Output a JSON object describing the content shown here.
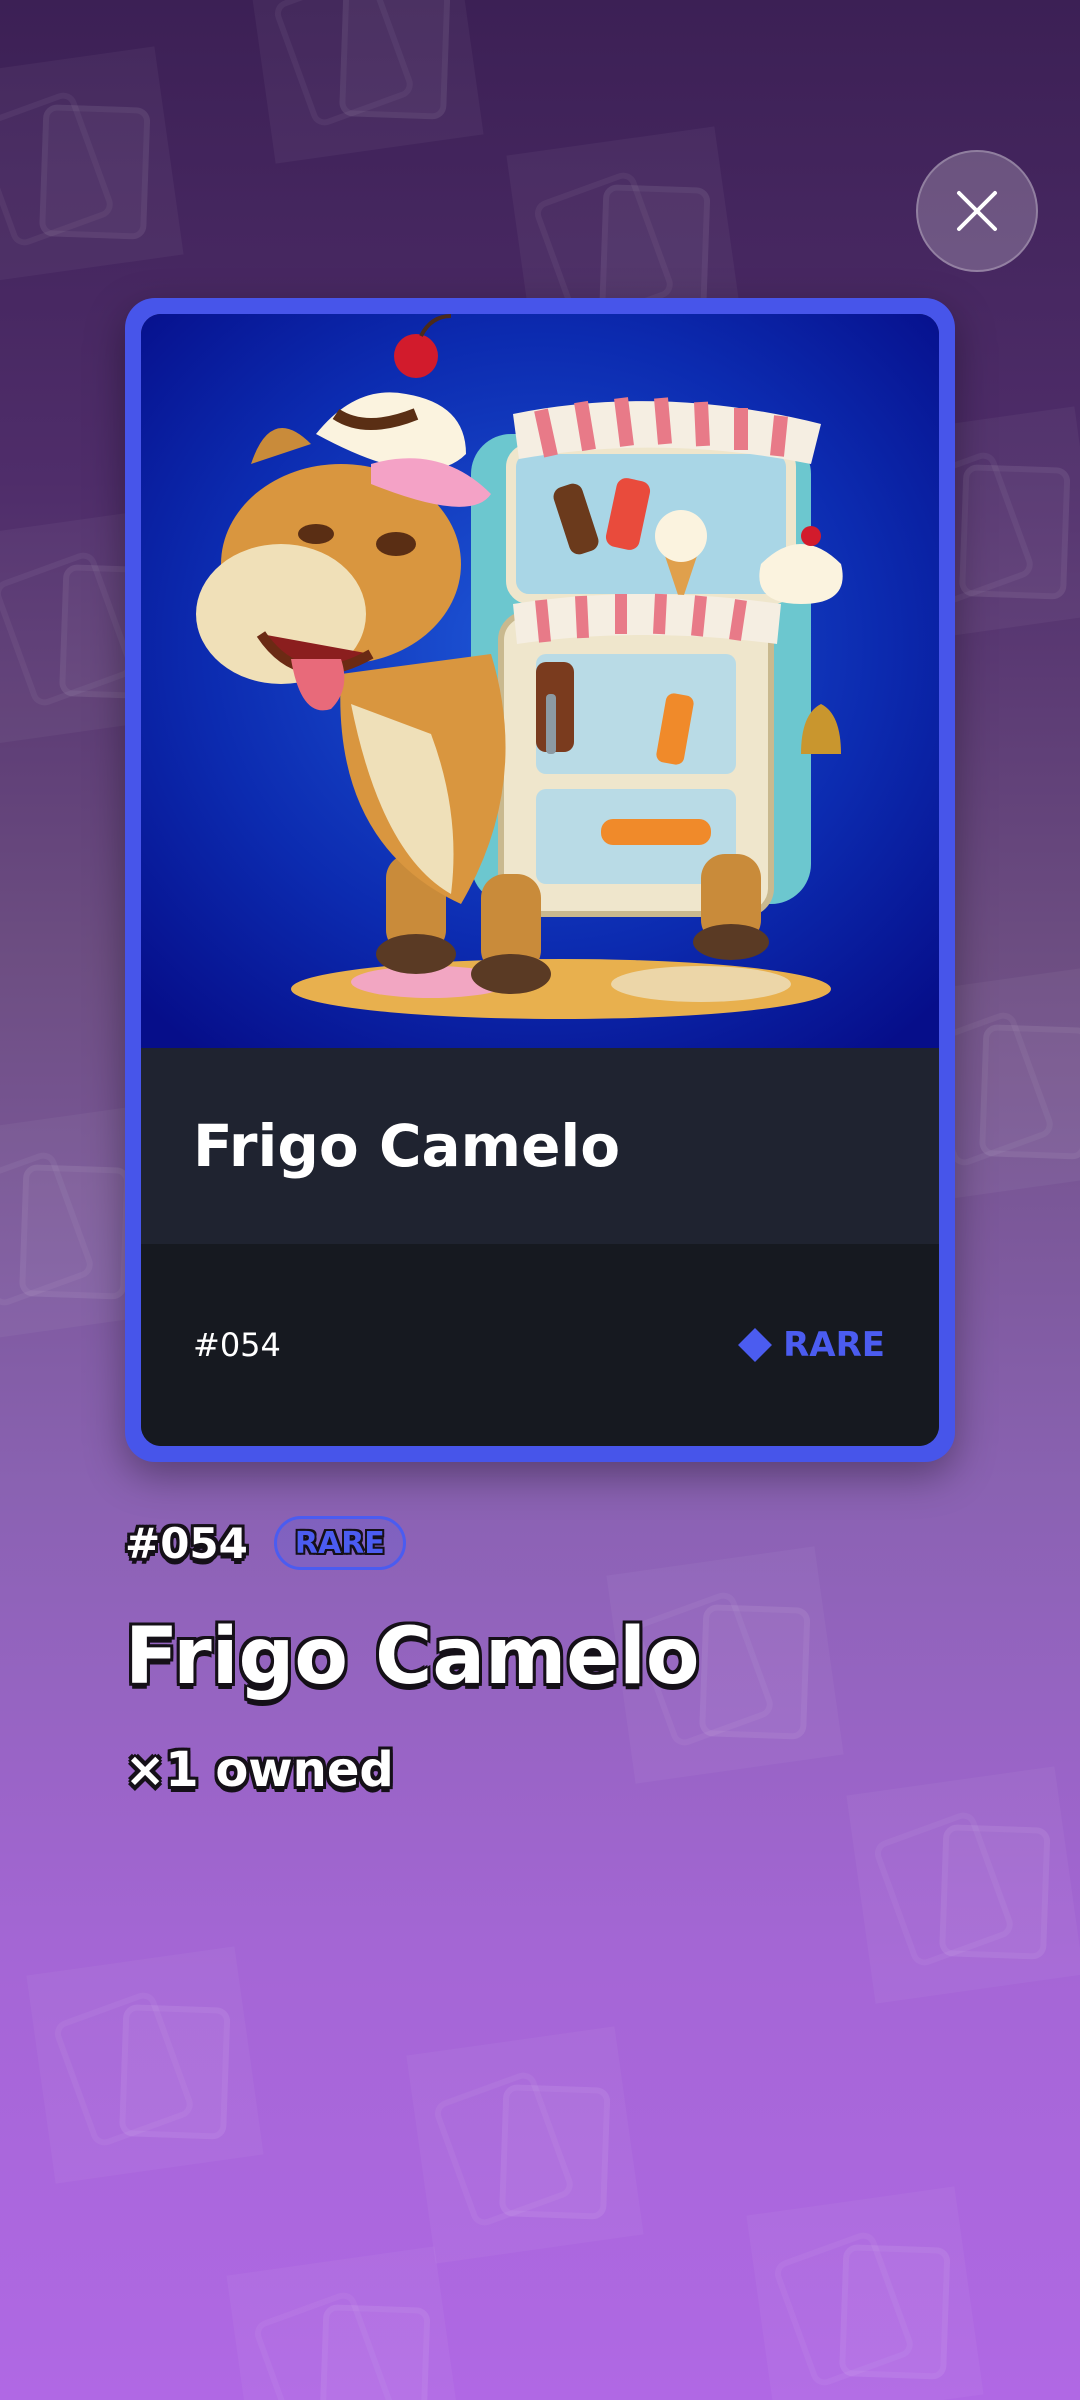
{
  "card": {
    "name": "Frigo Camelo",
    "number": "#054",
    "rarity": "RARE",
    "rarity_color": "#4b5cf0",
    "frame_color": "#4755ea",
    "art_background": "#0a1ea8"
  },
  "details": {
    "number": "#054",
    "rarity_badge": "RARE",
    "title": "Frigo Camelo",
    "owned_text": "×1 owned"
  },
  "icons": {
    "close": "close-icon",
    "rarity": "diamond-icon"
  }
}
